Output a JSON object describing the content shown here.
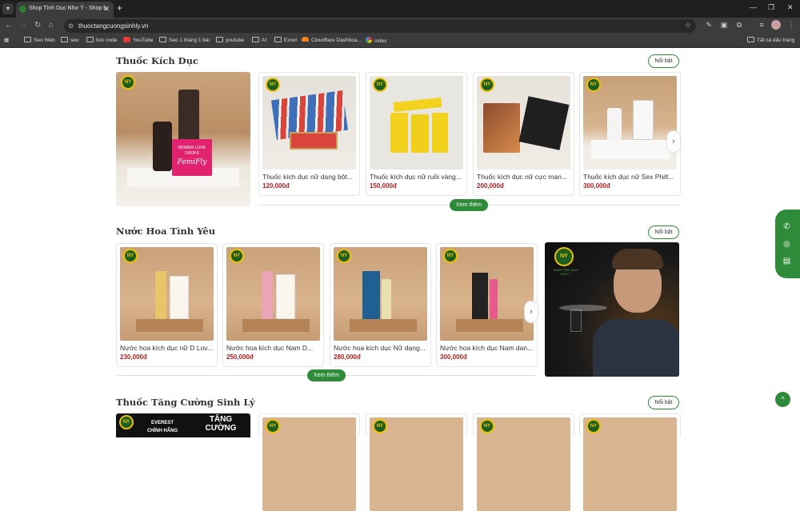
{
  "browser": {
    "tab_title": "Shop Tình Dục Như Ý - Shop b",
    "url": "thuoctangcuongsinhly.vn",
    "bookmarks": [
      "Seo Web",
      "seo",
      "hoc code",
      "YouTube",
      "Seo 1 tháng 1 bài",
      "youtube",
      "AI",
      "Excel",
      "Cloudflare Dashboa...",
      "index"
    ],
    "all_bookmarks": "Tất cả dấu trang"
  },
  "sections": [
    {
      "title": "Thuốc Kích Dục",
      "badge": "Nổi bật",
      "more": "Xem thêm",
      "products": [
        {
          "name": "Thuốc kích dục nữ dạng bột...",
          "price": "120,000đ"
        },
        {
          "name": "Thuốc kích dục nữ ruồi vàng...",
          "price": "150,000đ"
        },
        {
          "name": "Thuốc kích dục nữ cực man...",
          "price": "200,000đ"
        },
        {
          "name": "Thuốc kích dục nữ Sex Philt...",
          "price": "300,000đ"
        }
      ],
      "banner": {
        "product_text": "WOMEN LOVE DROPS",
        "brand": "FemiFly"
      }
    },
    {
      "title": "Nước Hoa Tình Yêu",
      "badge": "Nổi bật",
      "more": "Xem thêm",
      "products": [
        {
          "name": "Nước hoa kích dục nữ D Lov...",
          "price": "230,000đ"
        },
        {
          "name": "Nước hoa kích dục Nam D...",
          "price": "250,000đ"
        },
        {
          "name": "Nước hoa kích dục Nữ dạng...",
          "price": "280,000đ"
        },
        {
          "name": "Nước hoa kích dục Nam dan...",
          "price": "300,000đ"
        }
      ],
      "banner": {
        "logo_text": "SHOP TÌNH DỤC NHƯ Ý"
      }
    },
    {
      "title": "Thuốc Tăng Cường Sinh Lý",
      "badge": "Nổi bật",
      "banner": {
        "line1": "EVEREST",
        "line2": "CHÍNH HÃNG",
        "line3": "TĂNG",
        "line4": "CƯỜNG"
      }
    }
  ],
  "colors": {
    "accent": "#2e8b3a",
    "price": "#b71c1c"
  }
}
